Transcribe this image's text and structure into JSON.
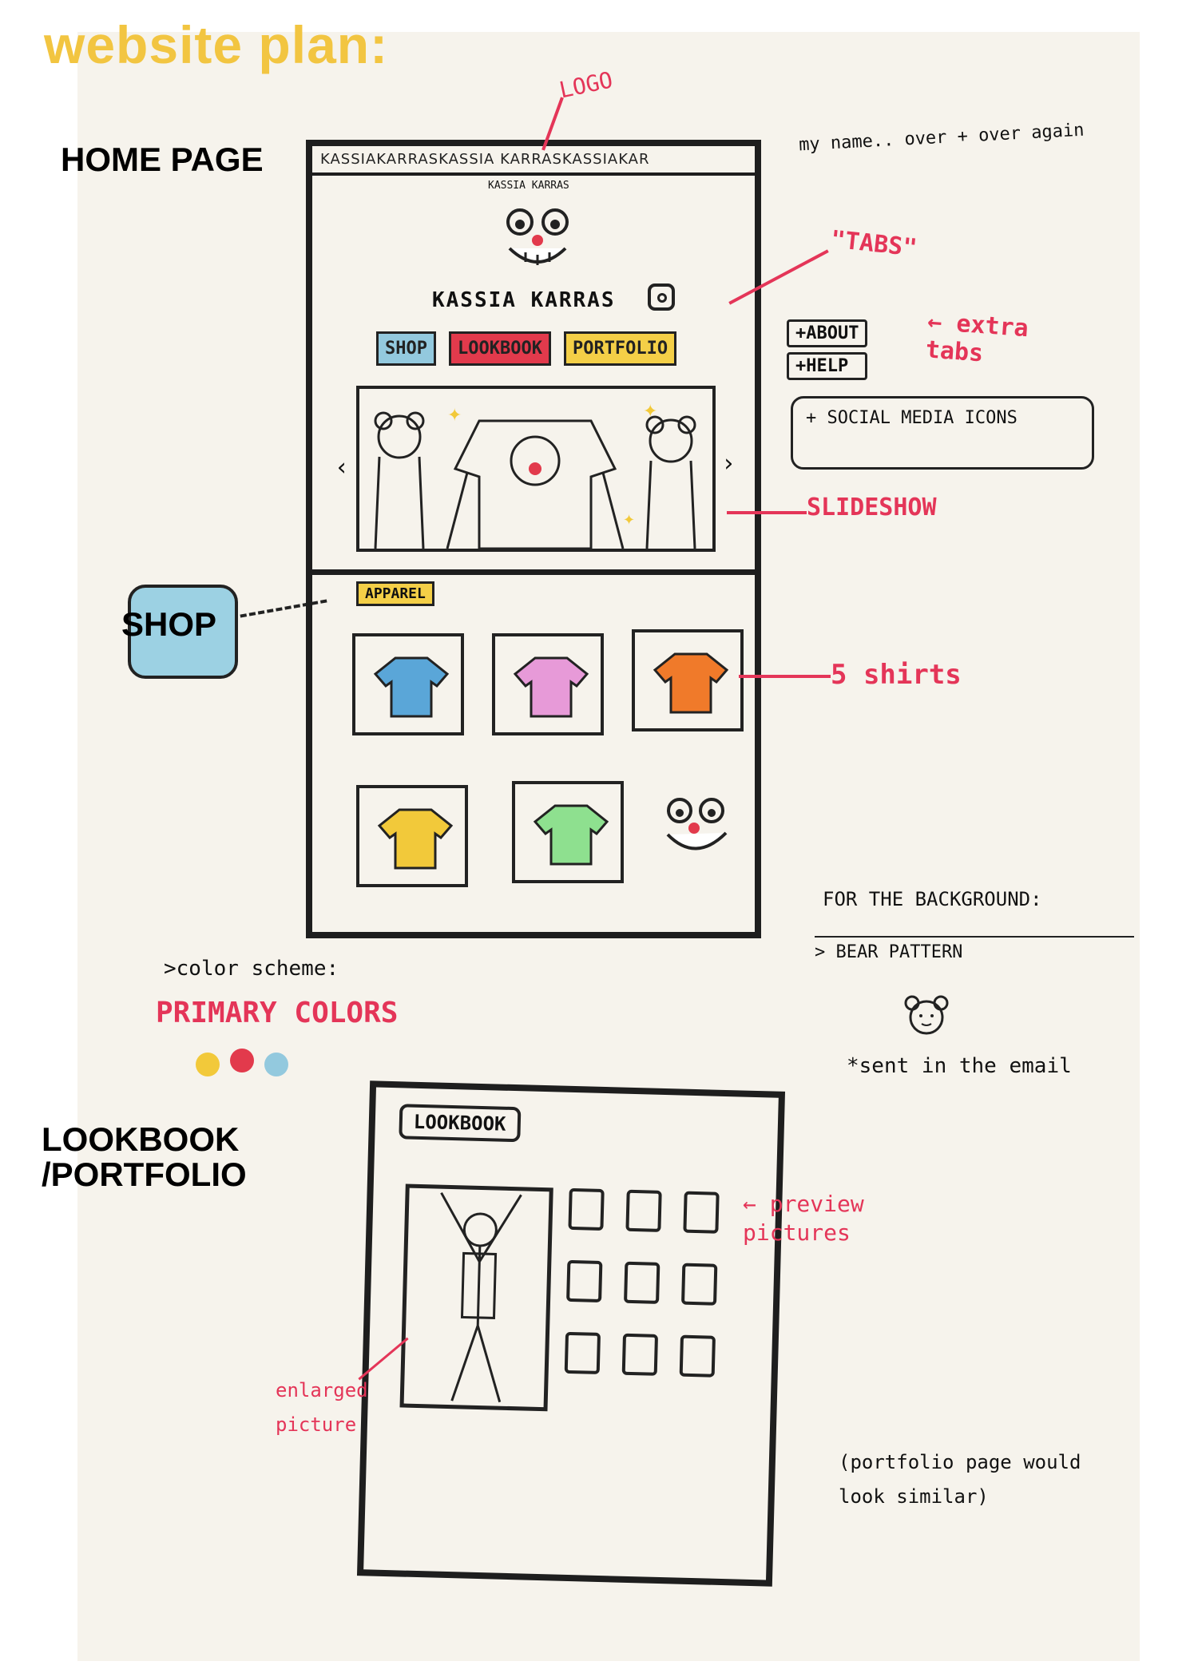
{
  "page_title": "website plan:",
  "sections": {
    "home": "HOME PAGE",
    "shop": "SHOP",
    "lookbook": "LOOKBOOK\n/PORTFOLIO"
  },
  "annotations": {
    "logo": "LOGO",
    "name_repeat": "my name.. over + over again",
    "tabs": "\"TABS\"",
    "extra_tabs": "← extra tabs",
    "slideshow": "SLIDESHOW",
    "five_shirts": "5 shirts",
    "background_heading": "FOR THE BACKGROUND:",
    "bear_pattern": "> BEAR PATTERN",
    "sent_email": "*sent in the email",
    "color_scheme": ">color scheme:",
    "primary_colors": "PRIMARY COLORS",
    "preview_pictures": "← preview pictures",
    "enlarged_picture": "enlarged picture",
    "portfolio_note": "(portfolio page would look similar)"
  },
  "home": {
    "name_strip": "KASSIAKARRASKASSIA KARRASKASSIAKAR",
    "brand_name": "KASSIA KARRAS",
    "logo_text": "KASSIA KARRAS",
    "tabs": [
      "SHOP",
      "LOOKBOOK",
      "PORTFOLIO"
    ],
    "extra_tabs": [
      "+ABOUT",
      "+HELP"
    ],
    "social": "+ SOCIAL MEDIA ICONS",
    "slide_prev": "‹",
    "slide_next": "›"
  },
  "shop": {
    "apparel": "APPAREL",
    "shirts": [
      {
        "color": "#5aa6d8"
      },
      {
        "color": "#e79ad8"
      },
      {
        "color": "#f07a2a"
      },
      {
        "color": "#f2c93a"
      },
      {
        "color": "#8ee08f"
      }
    ]
  },
  "lookbook": {
    "tab": "LOOKBOOK",
    "thumbnail_count": 9
  },
  "palette": [
    "#f2c93a",
    "#e23a4c",
    "#93c9de"
  ]
}
